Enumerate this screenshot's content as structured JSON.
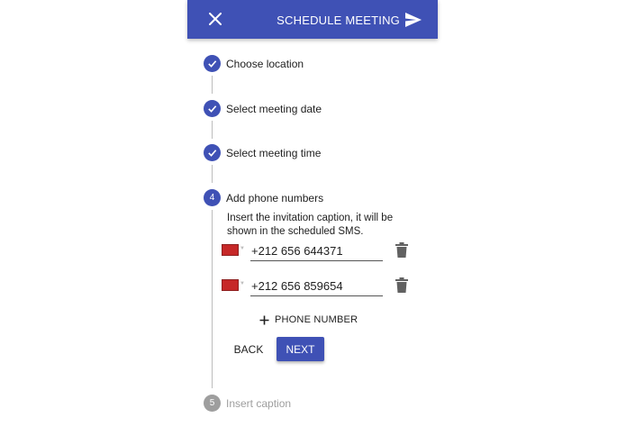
{
  "appbar": {
    "close_icon": "close-icon",
    "action_label": "SCHEDULE MEETING",
    "action_icon": "send-icon",
    "color": "#3f51b5"
  },
  "steps": [
    {
      "marker": "check",
      "label": "Choose location",
      "state": "completed"
    },
    {
      "marker": "check",
      "label": "Select meeting date",
      "state": "completed"
    },
    {
      "marker": "check",
      "label": "Select meeting time",
      "state": "completed"
    },
    {
      "marker": "4",
      "label": "Add phone numbers",
      "state": "active"
    },
    {
      "marker": "5",
      "label": "Insert caption",
      "state": "disabled"
    }
  ],
  "active_step": {
    "instruction": "Insert the invitation caption, it will be shown in the scheduled SMS.",
    "phones": [
      {
        "flag_icon": "flag-icon",
        "value": "+212 656 644371"
      },
      {
        "flag_icon": "flag-icon",
        "value": "+212 656 859654"
      }
    ],
    "add_label": "PHONE NUMBER",
    "back_label": "BACK",
    "next_label": "NEXT"
  }
}
